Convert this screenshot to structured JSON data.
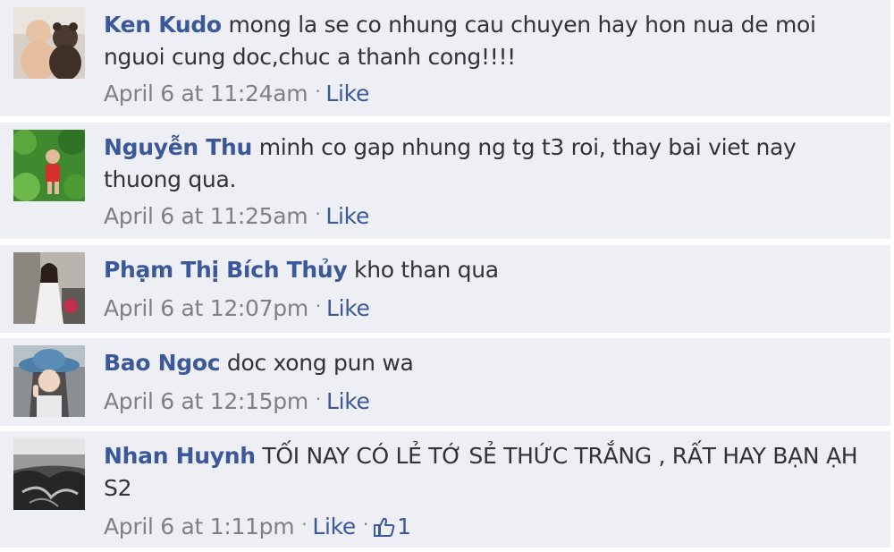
{
  "comments": [
    {
      "author": "Ken Kudo",
      "text": "mong la se co nhung cau chuyen hay hon nua de moi nguoi cung doc,chuc a thanh cong!!!!",
      "time": "April 6 at 11:24am",
      "like_label": "Like",
      "avatar_icon": "baby-with-teddy-bear-photo"
    },
    {
      "author": "Nguyễn Thu",
      "text": "minh co gap nhung ng tg t3 roi, thay bai viet nay thuong qua.",
      "time": "April 6 at 11:25am",
      "like_label": "Like",
      "avatar_icon": "girl-in-green-leaves-photo"
    },
    {
      "author": "Phạm Thị Bích Thủy",
      "text": "kho than qua",
      "time": "April 6 at 12:07pm",
      "like_label": "Like",
      "avatar_icon": "woman-in-ao-dai-photo"
    },
    {
      "author": "Bao Ngoc",
      "text": "doc xong pun wa",
      "time": "April 6 at 12:15pm",
      "like_label": "Like",
      "avatar_icon": "girl-in-blue-hat-photo"
    },
    {
      "author": "Nhan Huynh",
      "text": "TỐI NAY CÓ LẺ TỚ SẺ THỨC TRẮNG , RẤT HAY BẠN ẠH S2",
      "time": "April 6 at 1:11pm",
      "like_label": "Like",
      "like_count": "1",
      "avatar_icon": "black-and-white-photo"
    }
  ],
  "colors": {
    "author_link": "#3b5998",
    "comment_background": "#edeff4",
    "timestamp": "#808080"
  }
}
